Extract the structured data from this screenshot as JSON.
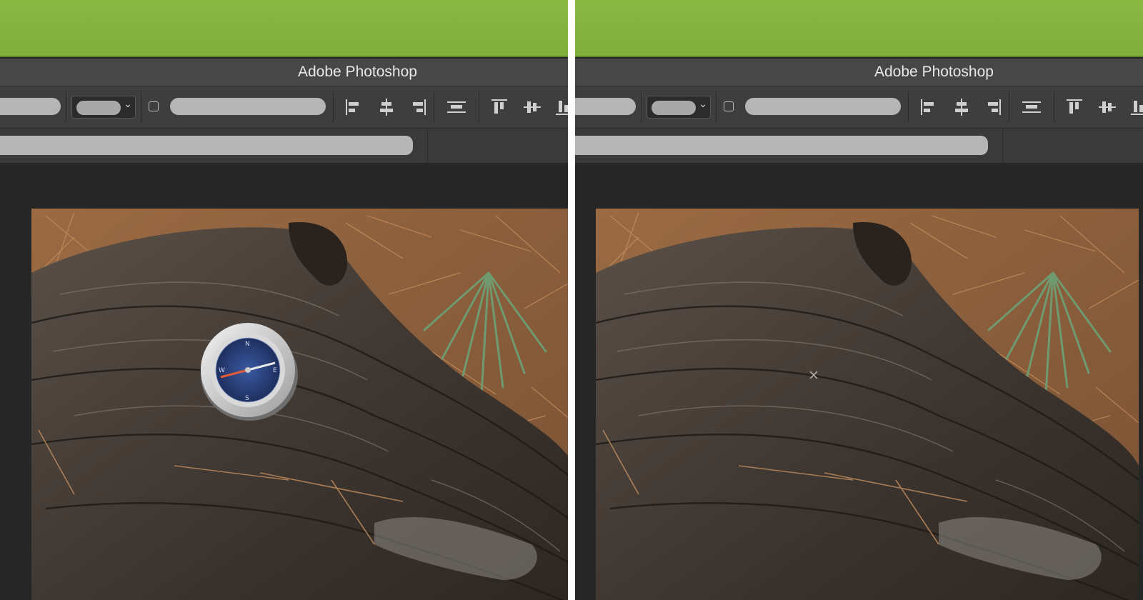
{
  "app": {
    "title": "Adobe Photoshop"
  },
  "panels": [
    {
      "id": "before",
      "compass_visible": true
    },
    {
      "id": "after",
      "compass_visible": false
    }
  ],
  "icons": {
    "toolbar": [
      "align-left-edges-icon",
      "align-horizontal-centers-icon",
      "align-right-edges-icon",
      "distribute-horizontal-icon",
      "align-top-edges-icon",
      "align-vertical-centers-icon",
      "align-bottom-edges-icon"
    ],
    "dropdown": "chevron-down-icon"
  },
  "colors": {
    "top_bar": "#8ab843",
    "title_bar": "#474747",
    "options_bar": "#3e3e3e",
    "workspace": "#262626",
    "placeholder_pill": "#b6b6b6"
  }
}
